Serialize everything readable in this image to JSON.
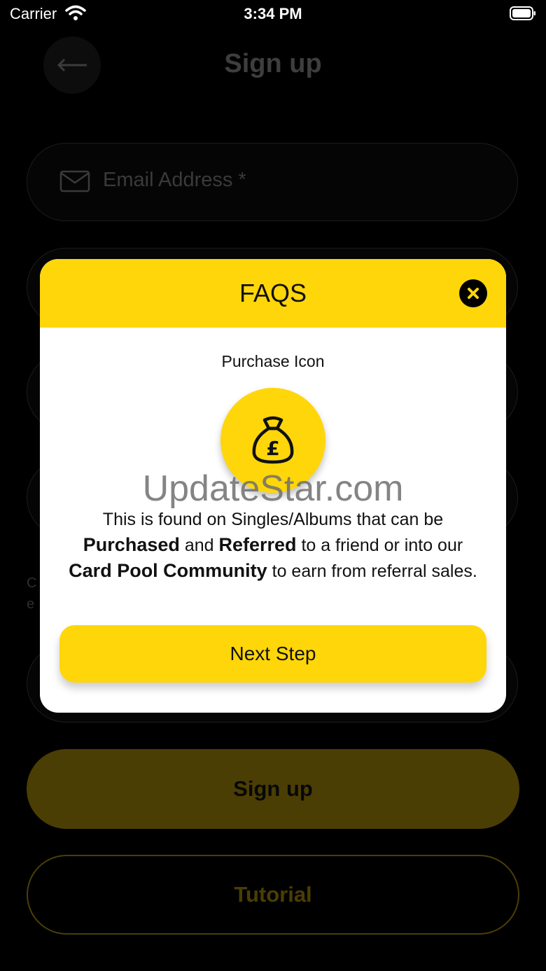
{
  "status_bar": {
    "carrier": "Carrier",
    "time": "3:34 PM",
    "icons": [
      "wifi-icon",
      "battery-icon"
    ]
  },
  "screen": {
    "title": "Sign up",
    "email_placeholder": "Email Address *",
    "hint_text": "C e",
    "signup_label": "Sign up",
    "tutorial_label": "Tutorial"
  },
  "modal": {
    "title": "FAQS",
    "icon_label": "Purchase Icon",
    "desc_line1": "This is found on Singles/Albums that can be",
    "desc_bold1": "Purchased",
    "desc_and": "and",
    "desc_bold2": "Referred",
    "desc_mid": "to a friend or into our",
    "desc_bold3": "Card Pool Community",
    "desc_end": "to earn from referral sales.",
    "next_label": "Next Step"
  },
  "watermark": "UpdateStar.com",
  "colors": {
    "accent": "#ffd60a",
    "background": "#000000",
    "dim_accent": "#4b3e04"
  }
}
